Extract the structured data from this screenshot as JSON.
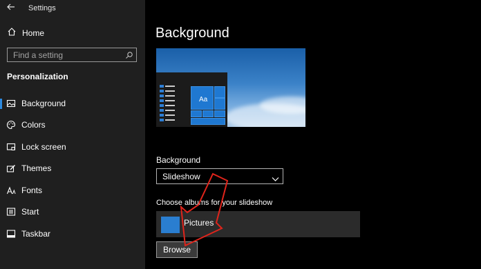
{
  "window": {
    "title": "Settings"
  },
  "sidebar": {
    "home_label": "Home",
    "search_placeholder": "Find a setting",
    "section_title": "Personalization",
    "items": [
      {
        "label": "Background",
        "icon": "picture-icon",
        "active": true
      },
      {
        "label": "Colors",
        "icon": "palette-icon",
        "active": false
      },
      {
        "label": "Lock screen",
        "icon": "lock-screen-icon",
        "active": false
      },
      {
        "label": "Themes",
        "icon": "brush-icon",
        "active": false
      },
      {
        "label": "Fonts",
        "icon": "fonts-icon",
        "active": false
      },
      {
        "label": "Start",
        "icon": "start-icon",
        "active": false
      },
      {
        "label": "Taskbar",
        "icon": "taskbar-icon",
        "active": false
      }
    ]
  },
  "main": {
    "title": "Background",
    "preview": {
      "tile_text": "Aa"
    },
    "background_label": "Background",
    "background_value": "Slideshow",
    "albums_label": "Choose albums for your slideshow",
    "album_name": "Pictures",
    "browse_label": "Browse"
  },
  "colors": {
    "accent": "#2d8ae0",
    "annotation_arrow": "#e0241b"
  }
}
